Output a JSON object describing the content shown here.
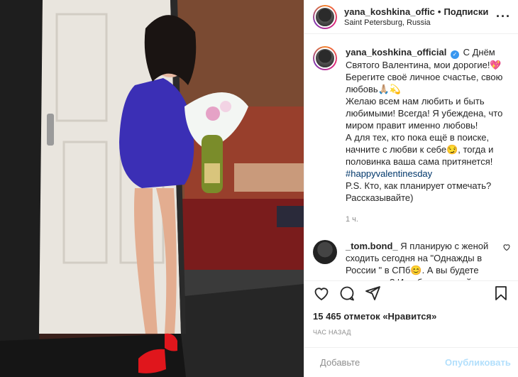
{
  "post_header": {
    "username": "yana_koshkina_offic",
    "separator": "•",
    "follow_label": "Подписки",
    "location": "Saint Petersburg, Russia",
    "more_icon": "more-icon"
  },
  "caption": {
    "username": "yana_koshkina_official",
    "text_lines": [
      "С Днём Святого Валентина, мои дорогие!💖",
      "Берегите своё личное счастье, свою любовь🙏🏼💫",
      "Желаю всем нам любить и быть любимыми! Всегда! Я убеждена, что миром правит именно любовь!",
      "А для тех, кто пока ещё в поиске, начните с любви к себе😏, тогда и половинка ваша сама притянется!"
    ],
    "hashtag": "#happyvalentinesday",
    "ps": "P.S. Кто, как планирует отмечать? Рассказывайте)",
    "time": "1 ч."
  },
  "comment": {
    "username": "_tom.bond_",
    "text": "Я планирую с женой сходить сегодня на \"Однажды в России \" в СПб😊. А вы будете выступать? Или без вас пройдет"
  },
  "actions": {
    "like_icon": "heart-icon",
    "comment_icon": "comment-icon",
    "share_icon": "share-icon",
    "save_icon": "bookmark-icon"
  },
  "likes": {
    "count": "15 465 отметок",
    "suffix": "«Нравится»"
  },
  "time_ago": "ЧАС НАЗАД",
  "add_comment": {
    "placeholder": "Добавьте",
    "publish_label": "Опубликовать"
  }
}
